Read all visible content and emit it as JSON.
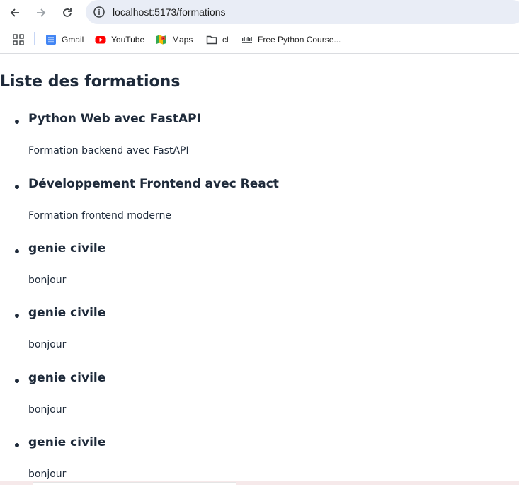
{
  "browser": {
    "url": "localhost:5173/formations",
    "nav": {
      "back_icon": "arrow-left-icon",
      "forward_icon": "arrow-right-icon",
      "reload_icon": "reload-icon",
      "info_icon": "info-icon"
    },
    "bookmarks": [
      {
        "label": "Gmail",
        "icon": "gmail-icon"
      },
      {
        "label": "YouTube",
        "icon": "youtube-icon"
      },
      {
        "label": "Maps",
        "icon": "maps-icon"
      },
      {
        "label": "cl",
        "icon": "folder-icon"
      },
      {
        "label": "Free Python Course...",
        "icon": "cisco-icon"
      }
    ],
    "apps_icon": "apps-grid-icon"
  },
  "page": {
    "title": "Liste des formations",
    "formations": [
      {
        "title": "Python Web avec FastAPI",
        "description": "Formation backend avec FastAPI"
      },
      {
        "title": "Développement Frontend avec React",
        "description": "Formation frontend moderne"
      },
      {
        "title": "genie civile",
        "description": "bonjour"
      },
      {
        "title": "genie civile",
        "description": "bonjour"
      },
      {
        "title": "genie civile",
        "description": "bonjour"
      },
      {
        "title": "genie civile",
        "description": "bonjour"
      }
    ]
  },
  "colors": {
    "text": "#1e2a3a",
    "omnibox_bg": "#e9edf6",
    "youtube_red": "#ff0000",
    "gmail_blue": "#4285f4"
  }
}
